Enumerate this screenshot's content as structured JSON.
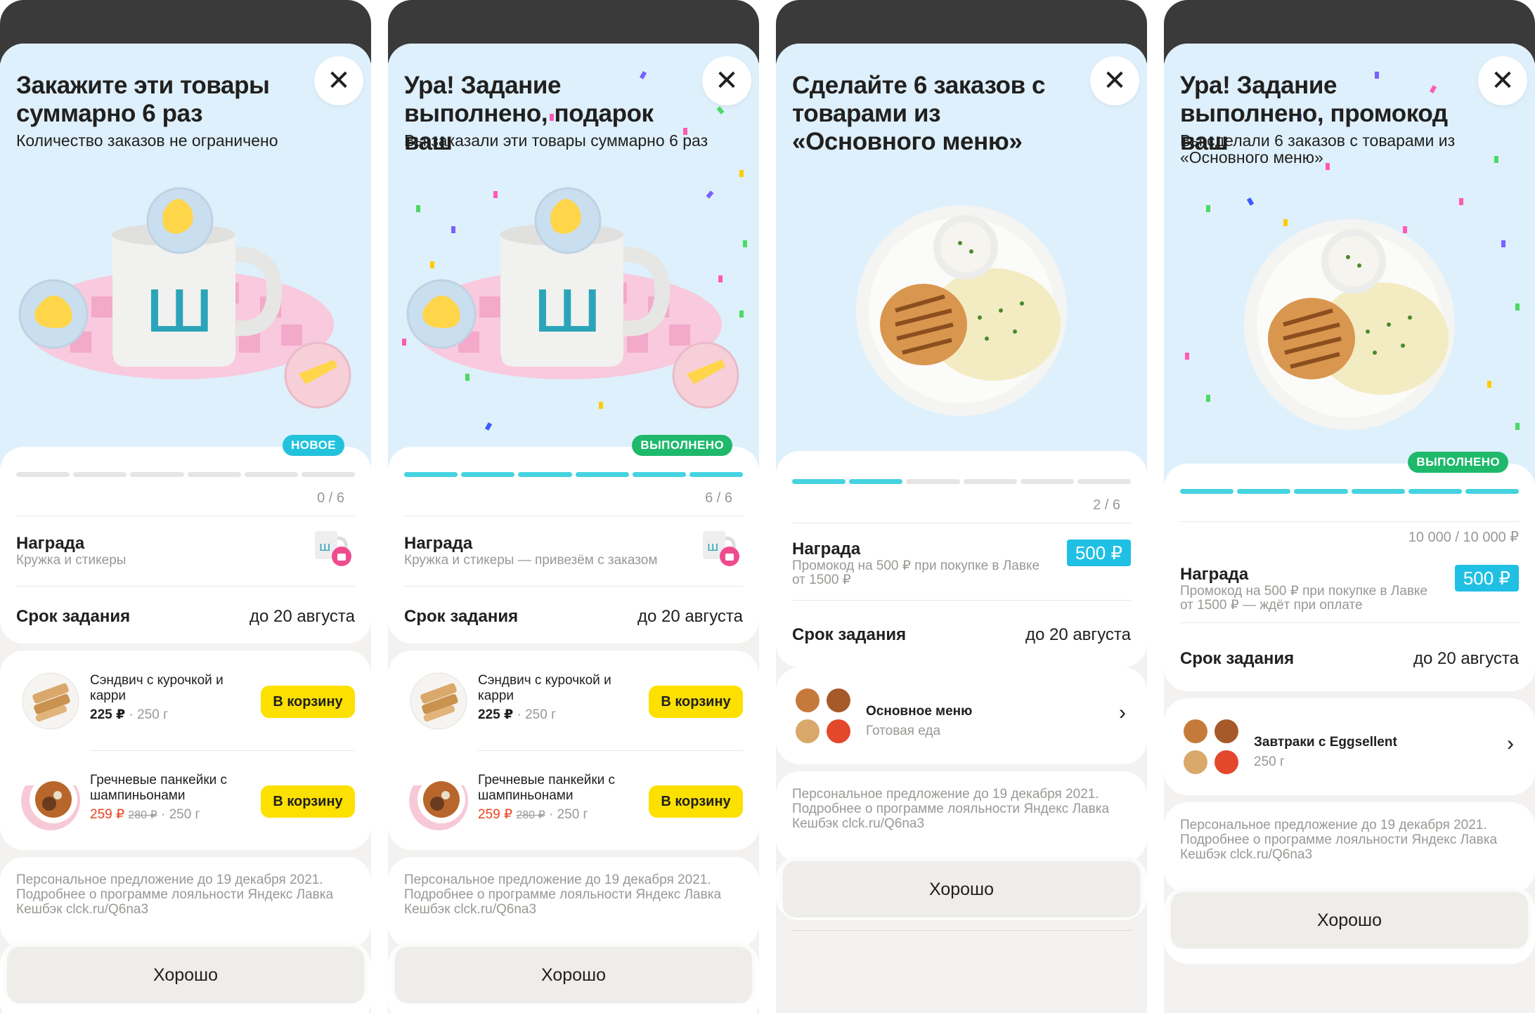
{
  "screens": [
    {
      "title": "Закажите эти товары суммарно 6 раз",
      "subtitle": "Количество заказов не ограничено",
      "badge": "НОВОЕ",
      "progress": "0 / 6",
      "progress_done": 0,
      "progress_total": 6,
      "reward_label": "Награда",
      "reward_sub": "Кружка и стикеры",
      "deadline_label": "Срок задания",
      "deadline_value": "до 20 августа",
      "products": [
        {
          "name": "Сэндвич с курочкой и карри",
          "price": "225 ₽",
          "weight": "250 г",
          "button": "В корзину"
        },
        {
          "name": "Гречневые панкейки с шампиньонами",
          "price": "259 ₽",
          "old_price": "280 ₽",
          "weight": "250 г",
          "button": "В корзину"
        }
      ],
      "footer": "Персональное предложение до 19 декабря 2021. Подробнее о программе лояльности Яндекс Лавка Кешбэк clck.ru/Q6na3",
      "ok": "Хорошо"
    },
    {
      "title": "Ура! Задание выполнено, подарок ваш",
      "subtitle": "Вы заказали эти товары суммарно 6 раз",
      "badge": "ВЫПОЛНЕНО",
      "progress": "6 / 6",
      "progress_done": 6,
      "progress_total": 6,
      "reward_label": "Награда",
      "reward_sub": "Кружка и стикеры — привезём с заказом",
      "deadline_label": "Срок задания",
      "deadline_value": "до 20 августа",
      "products": [
        {
          "name": "Сэндвич с курочкой и карри",
          "price": "225 ₽",
          "weight": "250 г",
          "button": "В корзину"
        },
        {
          "name": "Гречневые панкейки с шампиньонами",
          "price": "259 ₽",
          "old_price": "280 ₽",
          "weight": "250 г",
          "button": "В корзину"
        }
      ],
      "footer": "Персональное предложение до 19 декабря 2021. Подробнее о программе лояльности Яндекс Лавка Кешбэк clck.ru/Q6na3",
      "ok": "Хорошо"
    },
    {
      "title": "Сделайте 6 заказов с товарами из «Основного меню»",
      "progress": "2 / 6",
      "progress_done": 2,
      "progress_total": 6,
      "reward_label": "Награда",
      "reward_sub": "Промокод на 500 ₽ при покупке в Лавке от 1500 ₽",
      "promo": "500 ₽",
      "deadline_label": "Срок задания",
      "deadline_value": "до 20 августа",
      "category": {
        "title": "Основное меню",
        "sub": "Готовая еда"
      },
      "footer": "Персональное предложение до 19 декабря 2021. Подробнее о программе лояльности Яндекс Лавка Кешбэк clck.ru/Q6na3",
      "ok": "Хорошо"
    },
    {
      "title": "Ура! Задание выполнено, промокод ваш",
      "subtitle": "Вы сделали 6 заказов с товарами из «Основного меню»",
      "badge": "ВЫПОЛНЕНО",
      "progress": "10 000 / 10 000 ₽",
      "progress_done": 6,
      "progress_total": 6,
      "reward_label": "Награда",
      "reward_sub": "Промокод на 500 ₽ при покупке в Лавке от 1500 ₽ — ждёт при оплате",
      "promo": "500 ₽",
      "deadline_label": "Срок задания",
      "deadline_value": "до 20 августа",
      "category": {
        "title": "Завтраки с Eggsellent",
        "sub": "250 г"
      },
      "footer": "Персональное предложение до 19 декабря 2021. Подробнее о программе лояльности Яндекс Лавка Кешбэк clck.ru/Q6na3",
      "ok": "Хорошо"
    }
  ],
  "colors": {
    "hero_bg": "#def0fb",
    "accent_yellow": "#fce000",
    "progress_on": "#45d3e0",
    "badge_new": "#22c2dc",
    "badge_done": "#1fb96c",
    "promo": "#1fc0e4"
  },
  "icons": [
    "close-icon",
    "chevron-right-icon"
  ]
}
